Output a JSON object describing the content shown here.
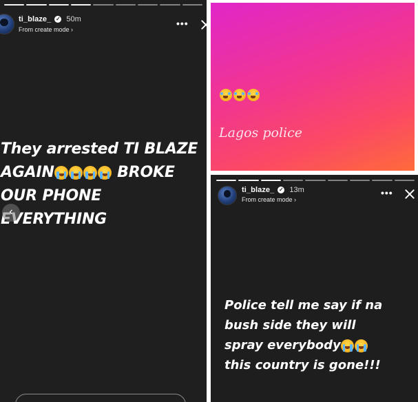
{
  "left_story": {
    "username": "ti_blaze_",
    "time": "50m",
    "source": "From create mode",
    "more_label": "•••",
    "text_lines": [
      {
        "text": "They arrested TI BLAZE",
        "emojis": 0
      },
      {
        "text": "AGAIN",
        "emojis": 4,
        "after": " BROKE"
      },
      {
        "text": "OUR PHONE",
        "emojis": 0
      },
      {
        "text": "EVERYTHING",
        "emojis": 0
      }
    ],
    "nav_label": "‹",
    "progress_segments": 9,
    "progress_filled": 4
  },
  "middle_story": {
    "emoji_count": 3,
    "caption": "Lagos police",
    "colors": {
      "start": "#e126c9",
      "end": "#ff6b3a"
    }
  },
  "right_story": {
    "username": "ti_blaze_",
    "time": "13m",
    "source": "From create mode",
    "more_label": "•••",
    "text_lines": [
      {
        "text": "Police tell me say if na",
        "emojis": 0
      },
      {
        "text": "bush side they will",
        "emojis": 0
      },
      {
        "text": "spray everybody",
        "emojis": 2
      },
      {
        "text": "this country is gone!!!",
        "emojis": 0
      }
    ],
    "progress_segments": 9,
    "progress_filled": 3
  }
}
